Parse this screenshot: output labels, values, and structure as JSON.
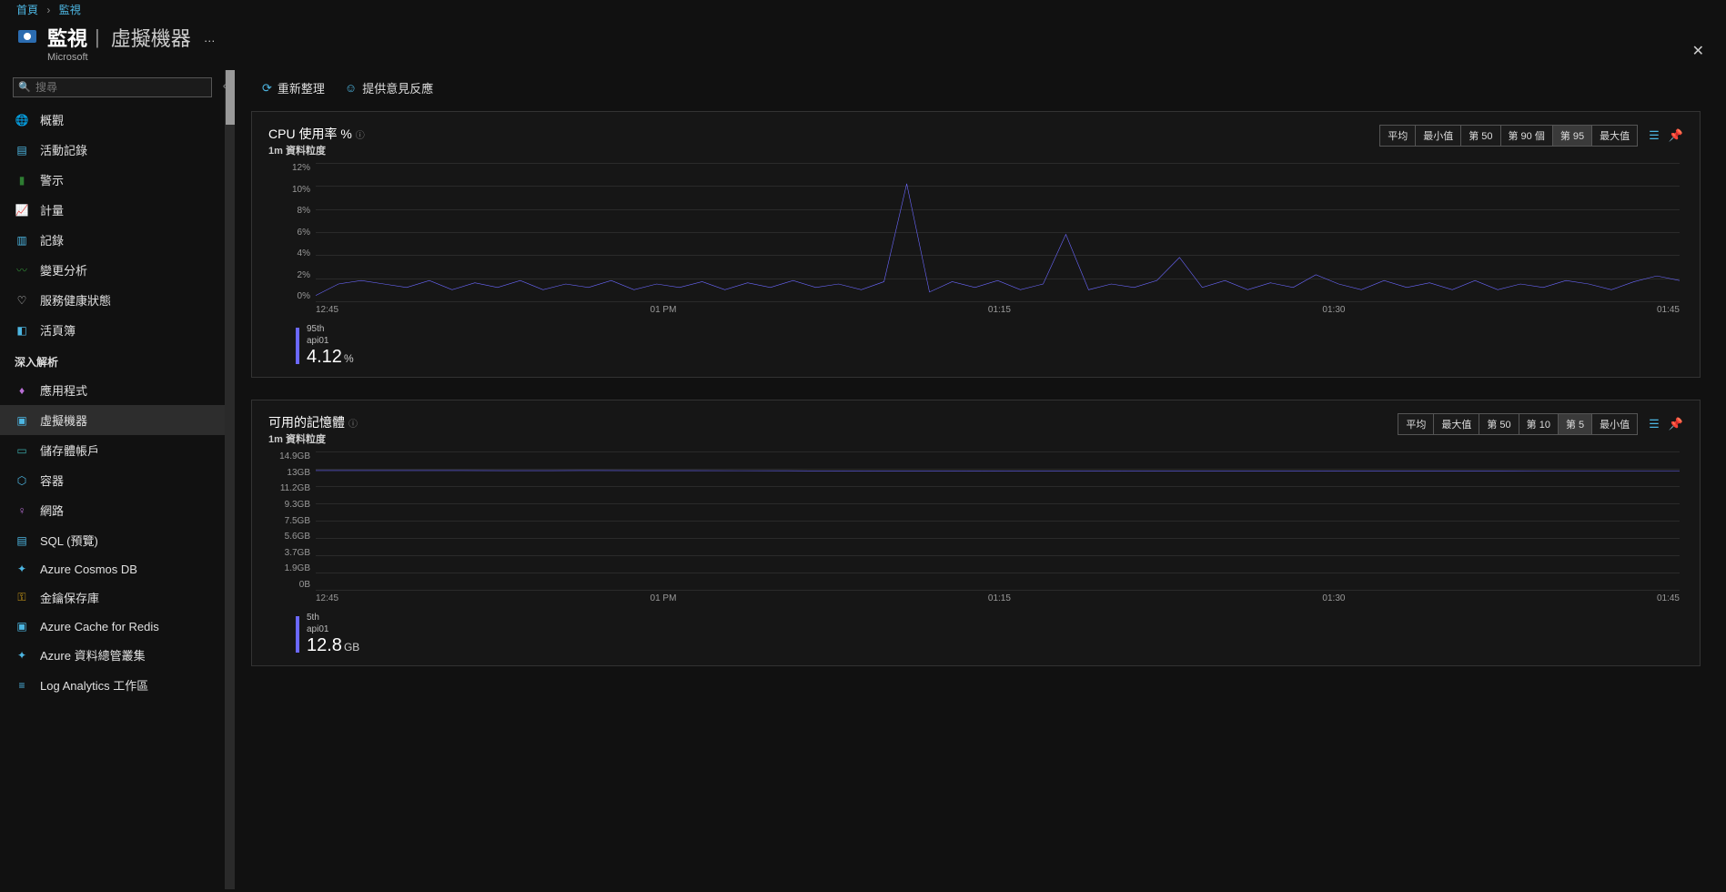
{
  "breadcrumb": {
    "home": "首頁",
    "current": "監視"
  },
  "header": {
    "title": "監視",
    "subtitle": "虛擬機器",
    "divider": "|",
    "org": "Microsoft"
  },
  "search": {
    "placeholder": "搜尋"
  },
  "toolbar": {
    "refresh": "重新整理",
    "feedback": "提供意見反應"
  },
  "sidebar": {
    "items": [
      {
        "label": "概觀",
        "icon": "🌐",
        "color": "#4db6e2"
      },
      {
        "label": "活動記錄",
        "icon": "▤",
        "color": "#4db6e2"
      },
      {
        "label": "警示",
        "icon": "▮",
        "color": "#2e7d32"
      },
      {
        "label": "計量",
        "icon": "📈",
        "color": "#4db6e2"
      },
      {
        "label": "記錄",
        "icon": "▥",
        "color": "#4db6e2"
      },
      {
        "label": "變更分析",
        "icon": "〰",
        "color": "#2e7d32"
      },
      {
        "label": "服務健康狀態",
        "icon": "♡",
        "color": "#ccc"
      },
      {
        "label": "活頁簿",
        "icon": "◧",
        "color": "#4db6e2"
      }
    ],
    "section": "深入解析",
    "items2": [
      {
        "label": "應用程式",
        "icon": "♦",
        "color": "#b96fd6"
      },
      {
        "label": "虛擬機器",
        "icon": "▣",
        "color": "#4db6e2",
        "active": true
      },
      {
        "label": "儲存體帳戶",
        "icon": "▭",
        "color": "#3aa6a6"
      },
      {
        "label": "容器",
        "icon": "⬡",
        "color": "#4db6e2"
      },
      {
        "label": "網路",
        "icon": "♀",
        "color": "#b96fd6"
      },
      {
        "label": "SQL (預覽)",
        "icon": "▤",
        "color": "#4db6e2"
      },
      {
        "label": "Azure Cosmos DB",
        "icon": "✦",
        "color": "#4db6e2"
      },
      {
        "label": "金鑰保存庫",
        "icon": "⚿",
        "color": "#d4a017"
      },
      {
        "label": "Azure Cache for Redis",
        "icon": "▣",
        "color": "#4db6e2"
      },
      {
        "label": "Azure 資料總管叢集",
        "icon": "✦",
        "color": "#4db6e2"
      },
      {
        "label": "Log Analytics 工作區",
        "icon": "≡",
        "color": "#4db6e2"
      }
    ]
  },
  "charts": {
    "cpu": {
      "title": "CPU 使用率 %",
      "granularity": "1m 資料粒度",
      "agg": [
        "平均",
        "最小值",
        "第 50",
        "第 90 個",
        "第 95",
        "最大值"
      ],
      "agg_active": 4,
      "series_stat": "95th",
      "series_name": "api01",
      "series_value": "4.12",
      "series_unit": "%"
    },
    "mem": {
      "title": "可用的記憶體",
      "granularity": "1m 資料粒度",
      "agg": [
        "平均",
        "最大值",
        "第 50",
        "第 10",
        "第 5",
        "最小值"
      ],
      "agg_active": 4,
      "series_stat": "5th",
      "series_name": "api01",
      "series_value": "12.8",
      "series_unit": "GB"
    }
  },
  "chart_data": [
    {
      "type": "line",
      "title": "CPU 使用率 %",
      "xlabel": "",
      "ylabel": "%",
      "ylim": [
        0,
        12
      ],
      "x_ticks": [
        "12:45",
        "01 PM",
        "01:15",
        "01:30",
        "01:45"
      ],
      "y_ticks": [
        "12%",
        "10%",
        "8%",
        "6%",
        "4%",
        "2%",
        "0%"
      ],
      "series": [
        {
          "name": "api01 (95th)",
          "values": [
            0.5,
            1.5,
            1.8,
            1.5,
            1.2,
            1.8,
            1.0,
            1.6,
            1.2,
            1.8,
            1.0,
            1.5,
            1.2,
            1.8,
            1.0,
            1.5,
            1.2,
            1.7,
            1.0,
            1.6,
            1.2,
            1.8,
            1.2,
            1.5,
            1.0,
            1.7,
            10.2,
            0.8,
            1.7,
            1.2,
            1.8,
            1.0,
            1.5,
            5.8,
            1.0,
            1.5,
            1.2,
            1.8,
            3.8,
            1.2,
            1.8,
            1.0,
            1.6,
            1.2,
            2.3,
            1.5,
            1.0,
            1.8,
            1.2,
            1.6,
            1.0,
            1.8,
            1.0,
            1.5,
            1.2,
            1.8,
            1.5,
            1.0,
            1.7,
            2.2,
            1.8
          ]
        }
      ]
    },
    {
      "type": "line",
      "title": "可用的記憶體",
      "xlabel": "",
      "ylabel": "GB",
      "ylim": [
        0,
        14.9
      ],
      "x_ticks": [
        "12:45",
        "01 PM",
        "01:15",
        "01:30",
        "01:45"
      ],
      "y_ticks": [
        "14.9GB",
        "13GB",
        "11.2GB",
        "9.3GB",
        "7.5GB",
        "5.6GB",
        "3.7GB",
        "1.9GB",
        "0B"
      ],
      "series": [
        {
          "name": "api01 (5th)",
          "values": [
            12.85,
            12.85,
            12.85,
            12.85,
            12.84,
            12.84,
            12.85,
            12.84,
            12.84,
            12.83,
            12.82,
            12.81,
            12.8,
            12.8,
            12.81,
            12.8,
            12.8,
            12.81,
            12.8,
            12.8,
            12.8,
            12.8,
            12.79,
            12.79,
            12.79,
            12.79,
            12.78,
            12.78,
            12.78,
            12.78
          ]
        }
      ]
    }
  ]
}
